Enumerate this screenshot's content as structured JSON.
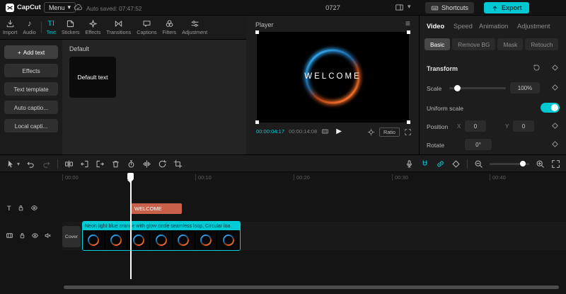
{
  "colors": {
    "accent": "#00c8d2",
    "text_clip": "#c9604a",
    "export_button": "#00c8d2"
  },
  "topbar": {
    "app_name": "CapCut",
    "menu_label": "Menu",
    "autosave_text": "Auto saved: 07:47:52",
    "project_title": "0727",
    "shortcuts_label": "Shortcuts",
    "export_label": "Export"
  },
  "media_panel": {
    "tabs": [
      {
        "label": "Import"
      },
      {
        "label": "Audio"
      },
      {
        "label": "Text"
      },
      {
        "label": "Stickers"
      },
      {
        "label": "Effects"
      },
      {
        "label": "Transitions"
      },
      {
        "label": "Captions"
      },
      {
        "label": "Filters"
      },
      {
        "label": "Adjustment"
      }
    ],
    "active_tab": "Text",
    "sidebar": [
      {
        "label": "Add text"
      },
      {
        "label": "Effects"
      },
      {
        "label": "Text template"
      },
      {
        "label": "Auto captio..."
      },
      {
        "label": "Local capti..."
      }
    ],
    "active_sidebar_item": "Add text",
    "section_title": "Default",
    "tile_label": "Default text"
  },
  "player": {
    "title": "Player",
    "overlay_text": "WELCOME",
    "current_time": "00:00:04:17",
    "duration": "00:00:14:08",
    "ratio_label": "Ratio"
  },
  "inspector": {
    "tabs": [
      {
        "label": "Video"
      },
      {
        "label": "Speed"
      },
      {
        "label": "Animation"
      },
      {
        "label": "Adjustment"
      }
    ],
    "active_tab": "Video",
    "subtabs": [
      {
        "label": "Basic"
      },
      {
        "label": "Remove BG"
      },
      {
        "label": "Mask"
      },
      {
        "label": "Retouch"
      }
    ],
    "active_subtab": "Basic",
    "transform": {
      "section_title": "Transform",
      "scale_label": "Scale",
      "scale_value": "100%",
      "uniform_label": "Uniform scale",
      "uniform_on": true,
      "position_label": "Position",
      "x_label": "X",
      "x_value": "0",
      "y_label": "Y",
      "y_value": "0",
      "rotate_label": "Rotate",
      "rotate_value": "0°"
    }
  },
  "timeline": {
    "ruler_marks": [
      {
        "label": "00:00"
      },
      {
        "label": "00:10"
      },
      {
        "label": "00:20"
      },
      {
        "label": "00:30"
      },
      {
        "label": "00:40"
      }
    ],
    "cover_label": "Cover",
    "text_clip_label": "WELCOME",
    "video_clip_title": "Neon light blue orange with glow circle seamless loop, Circular loa"
  },
  "icons": {
    "plus": "+",
    "caret_down": "▾",
    "audio_note": "♪",
    "text_tool": "TI",
    "hamburger": "≡",
    "play": "▶",
    "text_track": "T"
  }
}
